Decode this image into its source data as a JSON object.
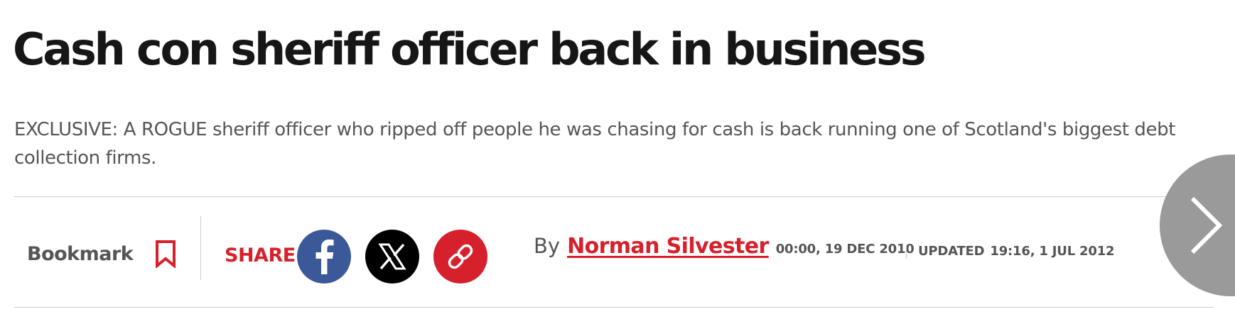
{
  "article": {
    "headline": "Cash con sheriff officer back in business",
    "standfirst": "EXCLUSIVE: A ROGUE sheriff officer who ripped off people he was chasing for cash is back running one of Scotland's biggest debt collection firms."
  },
  "toolbar": {
    "bookmark_label": "Bookmark",
    "bookmark_icon": "bookmark-icon",
    "share_label": "SHARE",
    "share_buttons": [
      {
        "icon": "facebook-icon",
        "color": "#3b5998"
      },
      {
        "icon": "x-icon",
        "color": "#000000"
      },
      {
        "icon": "link-icon",
        "color": "#d6202b"
      }
    ]
  },
  "byline": {
    "prefix": "By",
    "author": "Norman Silvester",
    "published": "00:00, 19 DEC 2010",
    "updated_label": "UPDATED",
    "updated": "19:16, 1 JUL 2012"
  },
  "navigation": {
    "next_icon": "chevron-right-icon"
  },
  "colors": {
    "accent": "#d6202b",
    "text_muted": "#555555",
    "headline": "#161616",
    "facebook": "#3b5998",
    "next_button": "#9a9a9a"
  }
}
